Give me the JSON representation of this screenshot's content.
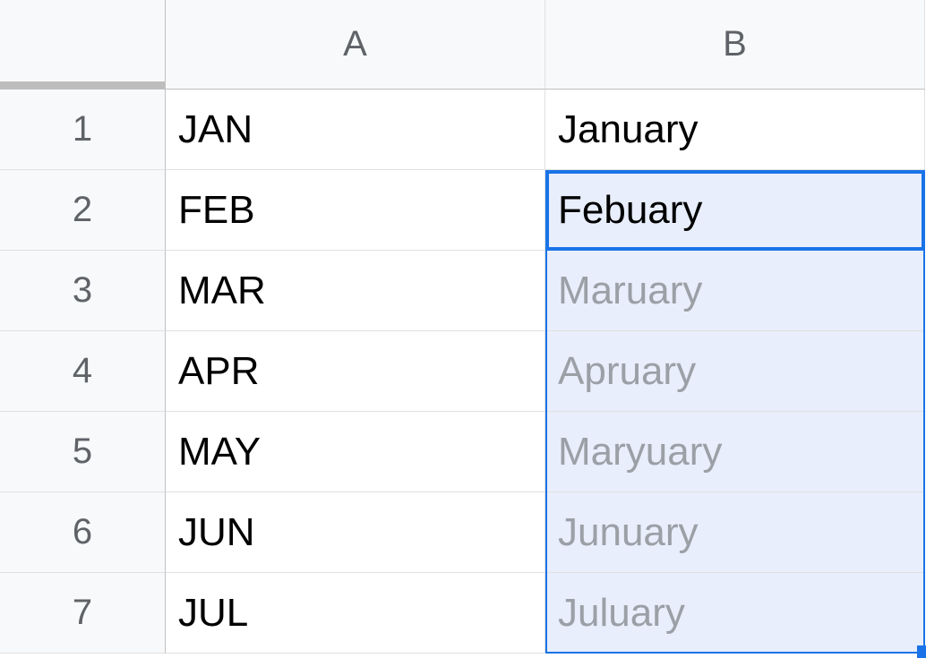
{
  "columns": {
    "A": "A",
    "B": "B"
  },
  "rows": [
    "1",
    "2",
    "3",
    "4",
    "5",
    "6",
    "7"
  ],
  "cells": {
    "A1": "JAN",
    "A2": "FEB",
    "A3": "MAR",
    "A4": "APR",
    "A5": "MAY",
    "A6": "JUN",
    "A7": "JUL",
    "B1": "January",
    "B2": "Febuary",
    "B3": "Maruary",
    "B4": "Apruary",
    "B5": "Maryuary",
    "B6": "Junuary",
    "B7": "Juluary"
  },
  "selection": {
    "active": "B2",
    "range_start": "B2",
    "range_end": "B7",
    "suggested": [
      "B3",
      "B4",
      "B5",
      "B6",
      "B7"
    ]
  }
}
